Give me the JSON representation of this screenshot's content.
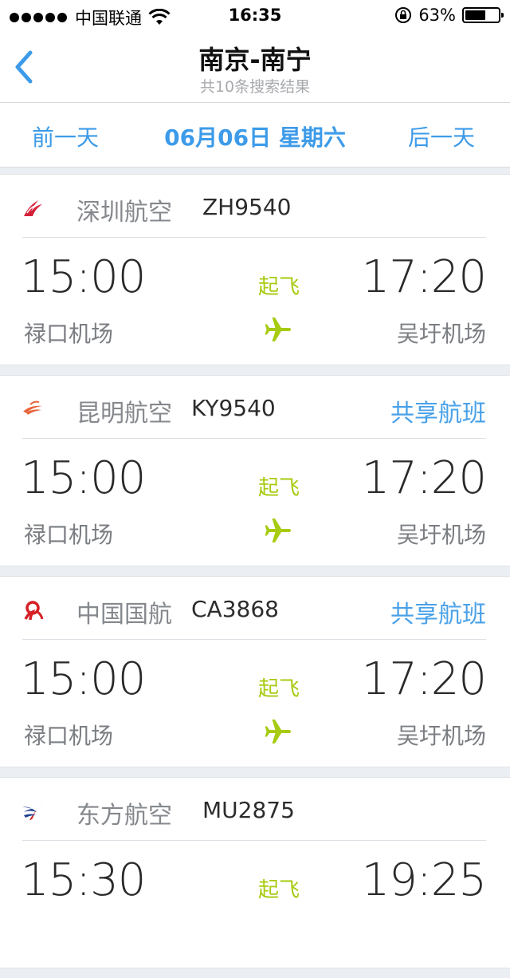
{
  "status_bar": {
    "carrier": "中国联通",
    "time": "16:35",
    "battery": "63%",
    "battery_level": 0.63
  },
  "nav": {
    "title": "南京-南宁",
    "subtitle": "共10条搜索结果",
    "back_icon": "chevron-left-icon"
  },
  "date_bar": {
    "prev": "前一天",
    "current": "06月06日  星期六",
    "next": "后一天"
  },
  "colors": {
    "accent_blue": "#3d9be9",
    "status_green": "#a6cb10",
    "shenzhen_red": "#d4213a",
    "kunming_orange": "#e8643c",
    "air_china_red": "#d71f26",
    "china_eastern_blue": "#1d3f8f"
  },
  "flights": [
    {
      "airline": "深圳航空",
      "logo_icon": "shenzhen-airlines-logo-icon",
      "flight_no": "ZH9540",
      "shared": "",
      "dep_time": "15:00",
      "arr_time": "17:20",
      "status": "起飞",
      "dep_airport": "禄口机场",
      "arr_airport": "吴圩机场"
    },
    {
      "airline": "昆明航空",
      "logo_icon": "kunming-airlines-logo-icon",
      "flight_no": "KY9540",
      "shared": "共享航班",
      "dep_time": "15:00",
      "arr_time": "17:20",
      "status": "起飞",
      "dep_airport": "禄口机场",
      "arr_airport": "吴圩机场"
    },
    {
      "airline": "中国国航",
      "logo_icon": "air-china-logo-icon",
      "flight_no": "CA3868",
      "shared": "共享航班",
      "dep_time": "15:00",
      "arr_time": "17:20",
      "status": "起飞",
      "dep_airport": "禄口机场",
      "arr_airport": "吴圩机场"
    },
    {
      "airline": "东方航空",
      "logo_icon": "china-eastern-logo-icon",
      "flight_no": "MU2875",
      "shared": "",
      "dep_time": "15:30",
      "arr_time": "19:25",
      "status": "起飞",
      "dep_airport": "",
      "arr_airport": ""
    }
  ]
}
